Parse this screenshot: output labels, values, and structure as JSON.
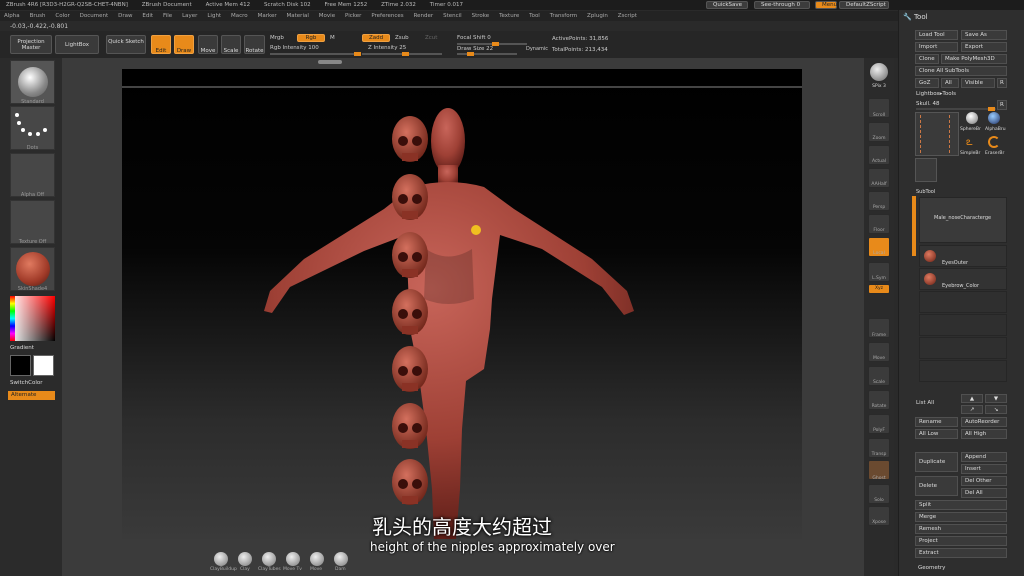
{
  "titlebar": {
    "items": [
      "ZBrush 4R6 [R3D3-H2GR-Q2SB-CHET-4NBN]",
      "ZBrush Document",
      "Active Mem 412",
      "Scratch Disk 102",
      "Free Mem 1252",
      "ZTime 2.032",
      "Timer 0.017"
    ],
    "quicksave": "QuickSave",
    "seethrough": "See-through 0",
    "menus": "Menus",
    "script": "DefaultZScript"
  },
  "menubar": [
    "Alpha",
    "Brush",
    "Color",
    "Document",
    "Draw",
    "Edit",
    "File",
    "Layer",
    "Light",
    "Macro",
    "Marker",
    "Material",
    "Movie",
    "Picker",
    "Preferences",
    "Render",
    "Stencil",
    "Stroke",
    "Texture",
    "Tool",
    "Transform",
    "Zplugin",
    "Zscript"
  ],
  "coords": "-0.03,-0.422,-0.801",
  "topshelf": {
    "projection_master": "Projection Master",
    "lightbox": "LightBox",
    "quick_sketch": "Quick Sketch",
    "edit": "Edit",
    "draw": "Draw",
    "move": "Move",
    "scale": "Scale",
    "rotate": "Rotate",
    "mrgb": "Mrgb",
    "rgb": "Rgb",
    "m": "M",
    "rgb_intensity": "Rgb Intensity 100",
    "zadd": "Zadd",
    "zsub": "Zsub",
    "zcut": "Zcut",
    "z_intensity": "Z Intensity 25",
    "focal_shift": "Focal Shift 0",
    "draw_size": "Draw Size 22",
    "dynamic": "Dynamic",
    "active_points": "ActivePoints: 31,856",
    "total_points": "TotalPoints: 213,434"
  },
  "leftshelf": {
    "brush_label": "Standard",
    "stroke_label": "Dots",
    "alpha_label": "Alpha Off",
    "texture_label": "Texture Off",
    "material_label": "SkinShade4",
    "gradient": "Gradient",
    "switch_color": "SwitchColor",
    "alternate": "Alternate"
  },
  "rightshelf": [
    "BPR",
    "SPix 3",
    "Scroll",
    "Zoom",
    "Actual",
    "AAHalf",
    "Persp",
    "Floor",
    "Local",
    "L.Sym",
    "Xyz",
    "",
    "",
    "Frame",
    "Move",
    "Scale",
    "Rotate",
    "PolyF",
    "Transp",
    "Ghost",
    "Solo",
    "Xpose"
  ],
  "toolpanel": {
    "title": "Tool",
    "load_tool": "Load Tool",
    "save_as": "Save As",
    "import": "Import",
    "export": "Export",
    "clone": "Clone",
    "make_polymesh": "Make PolyMesh3D",
    "clone_all": "Clone All SubTools",
    "goz": "GoZ",
    "all": "All",
    "visible": "Visible",
    "r": "R",
    "lightbox_tools": "Lightbox▸Tools",
    "skull": "Skull. 48",
    "r2": "R",
    "tool_thumbs": [
      "SphereBr",
      "AlphaBru",
      "SimpleBr",
      "EraserBr"
    ],
    "subtool": "SubTool",
    "subtools": [
      "Male_noseCharacterge",
      "EyesOuter",
      "Eyebrow_Color"
    ],
    "list_all": "List All",
    "rename": "Rename",
    "autoreorder": "AutoReorder",
    "all_low": "All Low",
    "all_high": "All High",
    "duplicate": "Duplicate",
    "append": "Append",
    "insert": "Insert",
    "delete": "Delete",
    "del_other": "Del Other",
    "del_all": "Del All",
    "split": "Split",
    "merge": "Merge",
    "remesh": "Remesh",
    "project": "Project",
    "extract": "Extract",
    "geometry": "Geometry"
  },
  "bottomshelf": [
    "ClayBuildup",
    "Clay",
    "ClayTubes",
    "Move Tv",
    "Move",
    "Dam"
  ],
  "subtitle": {
    "zh": "乳头的高度大约超过",
    "en": "height of the nipples approximately over"
  }
}
